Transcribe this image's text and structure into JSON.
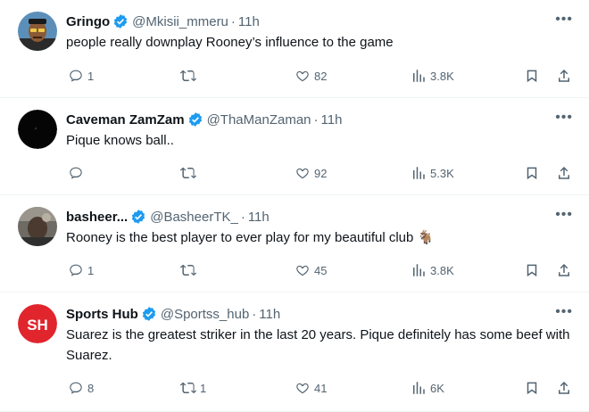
{
  "tweets": [
    {
      "name": "Gringo",
      "handle": "@Mkisii_mmeru",
      "separator": "·",
      "time": "11h",
      "text": "people really downplay Rooney’s influence to the game",
      "replies": "1",
      "retweets": "",
      "likes": "82",
      "views": "3.8K",
      "avatar_icon": "cartoon-man-avatar"
    },
    {
      "name": "Caveman ZamZam",
      "handle": "@ThaManZaman",
      "separator": "·",
      "time": "11h",
      "text": "Pique knows ball..",
      "replies": "",
      "retweets": "",
      "likes": "92",
      "views": "5.3K",
      "avatar_icon": "black-avatar"
    },
    {
      "name": "basheer...",
      "handle": "@BasheerTK_",
      "separator": "·",
      "time": "11h",
      "text": "Rooney is the best player to ever play for my beautiful club 🐐",
      "replies": "1",
      "retweets": "",
      "likes": "45",
      "views": "3.8K",
      "avatar_icon": "photo-avatar"
    },
    {
      "name": "Sports Hub",
      "handle": "@Sportss_hub",
      "separator": "·",
      "time": "11h",
      "text": "Suarez is the greatest striker in the last 20 years. Pique definitely has some beef with Suarez.",
      "replies": "8",
      "retweets": "1",
      "likes": "41",
      "views": "6K",
      "avatar_icon": "sh-logo-avatar",
      "avatar_text": "SH"
    }
  ],
  "colors": {
    "verified": "#1d9bf0",
    "muted": "#536471",
    "text": "#0f1419",
    "divider": "#eff3f4",
    "sh_red": "#e0252d"
  }
}
